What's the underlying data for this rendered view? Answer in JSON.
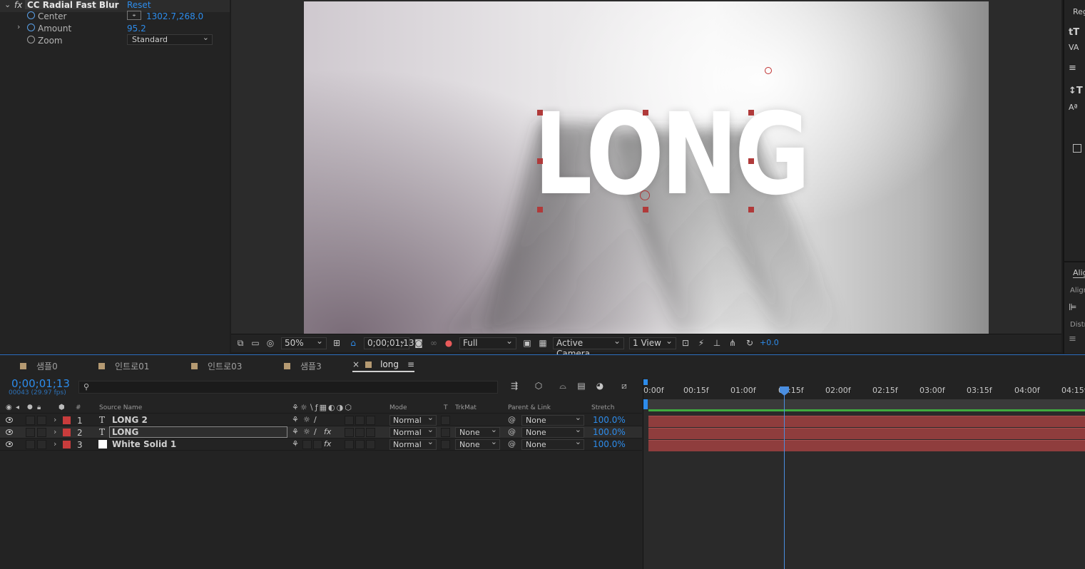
{
  "effect_controls": {
    "effect_name": "CC Radial Fast Blur",
    "reset_label": "Reset",
    "params": [
      {
        "label": "Center",
        "value": "1302.7,268.0"
      },
      {
        "label": "Amount",
        "value": "95.2"
      },
      {
        "label": "Zoom",
        "value": "Standard"
      }
    ]
  },
  "viewer": {
    "text": "LONG",
    "zoom": "50%",
    "timecode": "0;00;01;13",
    "resolution": "Full",
    "camera": "Active Camera",
    "views": "1 View",
    "exposure": "+0.0"
  },
  "right_panel": {
    "top_label": "Reg",
    "align_tab": "Alig",
    "align_label": "Align",
    "distribute_label": "Distr"
  },
  "timeline": {
    "tabs": [
      "샘플0",
      "인트로01",
      "인트로03",
      "샘플3",
      "long"
    ],
    "current_time": "0;00;01;13",
    "frame_info": "00043 (29.97 fps)",
    "columns": {
      "hash": "#",
      "source_name": "Source Name",
      "mode": "Mode",
      "t": "T",
      "trkmat": "TrkMat",
      "parent": "Parent & Link",
      "stretch": "Stretch"
    },
    "layers": [
      {
        "num": "1",
        "type": "T",
        "name": "LONG 2",
        "mode": "Normal",
        "trkmat": "",
        "parent": "None",
        "stretch": "100.0%"
      },
      {
        "num": "2",
        "type": "T",
        "name": "LONG",
        "mode": "Normal",
        "trkmat": "None",
        "parent": "None",
        "stretch": "100.0%"
      },
      {
        "num": "3",
        "type": "",
        "name": "White Solid 1",
        "mode": "Normal",
        "trkmat": "None",
        "parent": "None",
        "stretch": "100.0%"
      }
    ],
    "ruler": [
      "0:00f",
      "00:15f",
      "01:00f",
      "01:15f",
      "02:00f",
      "02:15f",
      "03:00f",
      "03:15f",
      "04:00f",
      "04:15f"
    ]
  },
  "colors": {
    "accent": "#2d8ceb",
    "layer_label": "#c83c3c",
    "layer_bar": "#8f3d3d",
    "tab_swatch": "#b59a72"
  }
}
